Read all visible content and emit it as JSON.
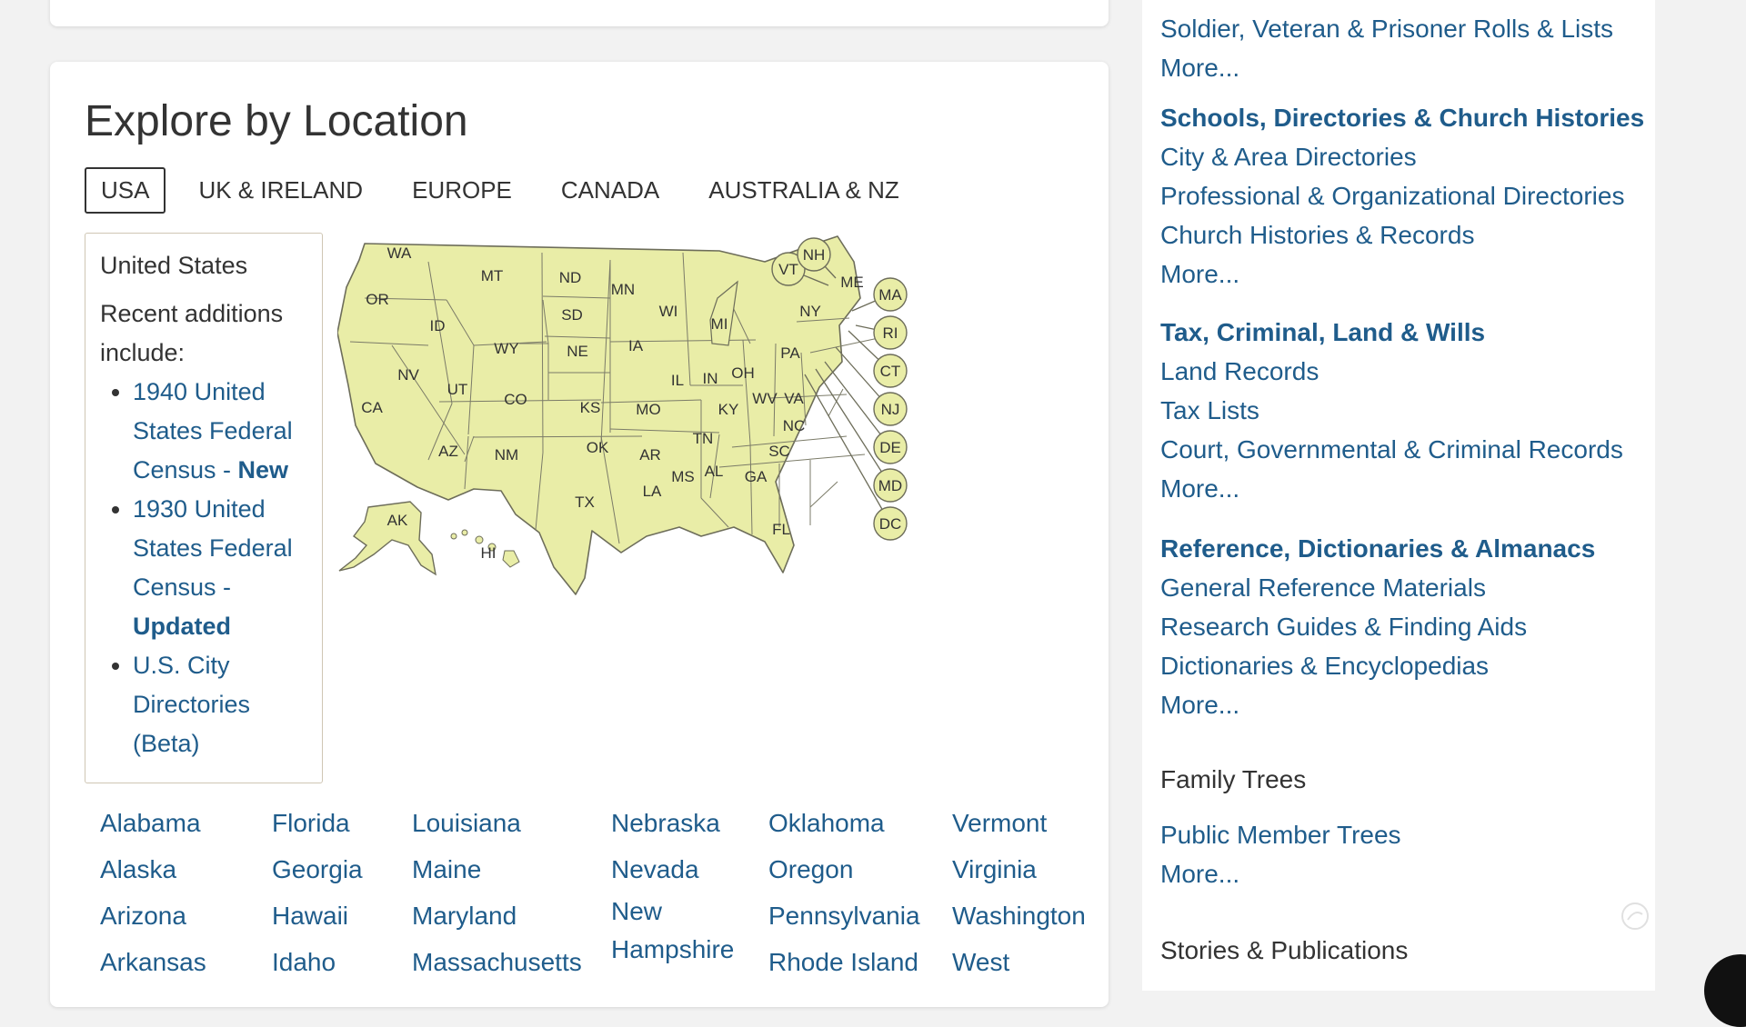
{
  "explore": {
    "title": "Explore by Location",
    "tabs": [
      "USA",
      "UK & IRELAND",
      "EUROPE",
      "CANADA",
      "AUSTRALIA & NZ"
    ],
    "active_tab": "USA"
  },
  "recent": {
    "country": "United States",
    "intro": "Recent additions include:",
    "items": [
      {
        "label": "1940 United States Federal Census - ",
        "tag": "New"
      },
      {
        "label": "1930 United States Federal Census - ",
        "tag": "Updated"
      },
      {
        "label": "U.S. City Directories (Beta)",
        "tag": ""
      }
    ]
  },
  "map": {
    "fill_color": "#e9eda7",
    "stroke_color": "#6d6d5a",
    "state_labels": [
      "WA",
      "OR",
      "CA",
      "ID",
      "NV",
      "MT",
      "WY",
      "UT",
      "AZ",
      "CO",
      "NM",
      "ND",
      "SD",
      "NE",
      "KS",
      "OK",
      "TX",
      "MN",
      "IA",
      "MO",
      "AR",
      "LA",
      "WI",
      "IL",
      "MI",
      "IN",
      "OH",
      "KY",
      "TN",
      "MS",
      "AL",
      "GA",
      "FL",
      "SC",
      "NC",
      "VA",
      "WV",
      "PA",
      "NY",
      "AK",
      "HI"
    ],
    "circle_labels": [
      "VT",
      "NH",
      "ME",
      "MA",
      "RI",
      "CT",
      "NJ",
      "DE",
      "MD",
      "DC"
    ]
  },
  "states": {
    "col1": [
      "Alabama",
      "Alaska",
      "Arizona",
      "Arkansas"
    ],
    "col2": [
      "Florida",
      "Georgia",
      "Hawaii",
      "Idaho"
    ],
    "col3": [
      "Louisiana",
      "Maine",
      "Maryland",
      "Massachusetts"
    ],
    "col4": [
      "Nebraska",
      "Nevada",
      "New Hampshire"
    ],
    "col5": [
      "Oklahoma",
      "Oregon",
      "Pennsylvania",
      "Rhode Island"
    ],
    "col6": [
      "Vermont",
      "Virginia",
      "Washington",
      "West"
    ]
  },
  "right": {
    "military": {
      "links": [
        "Soldier, Veteran & Prisoner Rolls & Lists",
        "More..."
      ]
    },
    "schools": {
      "heading": "Schools, Directories & Church Histories",
      "links": [
        "City & Area Directories",
        "Professional & Organizational Directories",
        "Church Histories & Records",
        "More..."
      ]
    },
    "tax": {
      "heading": "Tax, Criminal, Land & Wills",
      "links": [
        "Land Records",
        "Tax Lists",
        "Court, Governmental & Criminal Records",
        "More..."
      ]
    },
    "reference": {
      "heading": "Reference, Dictionaries & Almanacs",
      "links": [
        "General Reference Materials",
        "Research Guides & Finding Aids",
        "Dictionaries & Encyclopedias",
        "More..."
      ]
    },
    "family_trees": {
      "heading": "Family Trees",
      "links": [
        "Public Member Trees",
        "More..."
      ]
    },
    "stories": {
      "heading": "Stories & Publications"
    }
  }
}
